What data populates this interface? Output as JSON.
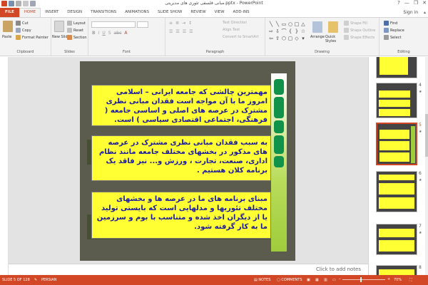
{
  "window": {
    "title": "مبانی فلسفی تئوری های مدیریتی.pptx - PowerPoint",
    "controls": [
      "?",
      "—",
      "❐",
      "✕"
    ]
  },
  "tabs": {
    "file": "FILE",
    "items": [
      "HOME",
      "INSERT",
      "DESIGN",
      "TRANSITIONS",
      "ANIMATIONS",
      "SLIDE SHOW",
      "REVIEW",
      "VIEW",
      "ADD-INS"
    ],
    "active": "HOME",
    "sign_in": "Sign in"
  },
  "ribbon": {
    "clipboard": {
      "label": "Clipboard",
      "paste": "Paste",
      "cut": "Cut",
      "copy": "Copy",
      "format_painter": "Format Painter"
    },
    "slides": {
      "label": "Slides",
      "new_slide": "New Slide",
      "layout": "Layout",
      "reset": "Reset",
      "section": "Section"
    },
    "font": {
      "label": "Font"
    },
    "paragraph": {
      "label": "Paragraph",
      "text_direction": "Text Direction",
      "align_text": "Align Text",
      "convert_smartart": "Convert to SmartArt"
    },
    "drawing": {
      "label": "Drawing",
      "arrange": "Arrange",
      "quick_styles": "Quick Styles",
      "shape_fill": "Shape Fill",
      "shape_outline": "Shape Outline",
      "shape_effects": "Shape Effects"
    },
    "editing": {
      "label": "Editing",
      "find": "Find",
      "replace": "Replace",
      "select": "Select"
    }
  },
  "slide": {
    "box1": "مهمترین چالشی که جامعه ایرانی – اسلامی امروز ما با آن مواجه است فقدان مبانی نظری مشترک در عرصه های اصلی و اساسی جامعه ( فرهنگی، اجتماعی اقتصادی سیاسی ) است.",
    "box2": "به سبب فقدان مبانی نظری مشترک در عرصه های مذکور در بخشهای مختلف جامعه مانند نظام اداری، صنعت، تجارت ، ورزش و... نیز فاقد یک برنامه کلان هستیم .",
    "box3": "مبنای برنامه های ما در عرصه ها و بخشهای مختلف تئوریها و مدلهایی است که بایستی تولید یا از دیگران اخذ شده و متناسب با بوم و سرزمین ما به کار گرفته شود."
  },
  "notes_placeholder": "Click to add notes",
  "thumbnails": [
    {
      "num": "",
      "star": ""
    },
    {
      "num": "4",
      "star": "★"
    },
    {
      "num": "5",
      "star": "★"
    },
    {
      "num": "6",
      "star": "★"
    },
    {
      "num": "7",
      "star": "★"
    },
    {
      "num": "8",
      "star": ""
    }
  ],
  "status": {
    "slide_of": "SLIDE 5 OF 128",
    "language": "PERSIAN",
    "notes": "NOTES",
    "comments": "COMMENTS",
    "zoom": "70%"
  },
  "colors": {
    "accent": "#d24726",
    "textbox_fill": "#ffff33",
    "textbox_text": "#1a1aa0",
    "band_green": "#10924a"
  }
}
